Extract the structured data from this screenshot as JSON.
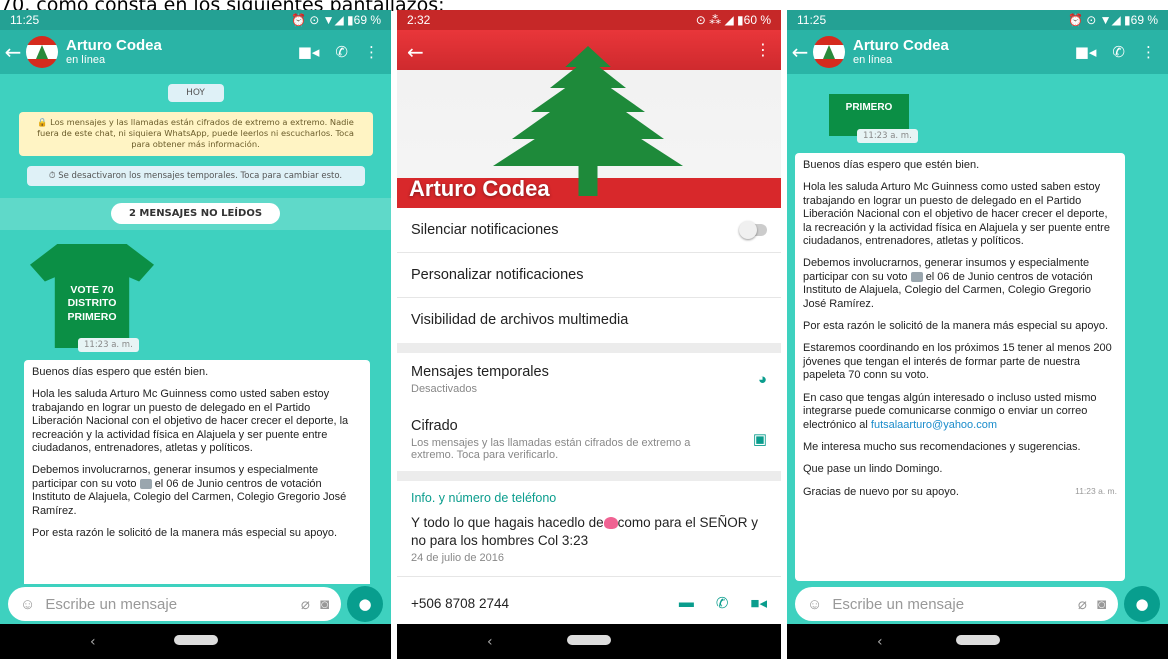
{
  "caption": "70, como consta en los siguientes pantallazos:",
  "panel1": {
    "status_time": "11:25",
    "status_right": "⏰ ⊙ ▼◢ ▮69 %",
    "contact_name": "Arturo Codea",
    "contact_status": "en línea",
    "date_badge": "HOY",
    "encryption_notice": "🔒 Los mensajes y las llamadas están cifrados de extremo a extremo. Nadie fuera de este chat, ni siquiera WhatsApp, puede leerlos ni escucharlos. Toca para obtener más información.",
    "temp_notice": "⏱ Se desactivaron los mensajes temporales. Toca para cambiar esto.",
    "unread_label": "2 MENSAJES NO LEÍDOS",
    "shirt_text": "VOTE 70\nDISTRITO\nPRIMERO",
    "image_time": "11:23 a. m.",
    "msg_p1": "Buenos días espero que estén bien.",
    "msg_p2": "Hola les saluda Arturo Mc Guinness como usted saben estoy trabajando en lograr un puesto de delegado en el Partido Liberación Nacional con el objetivo de hacer crecer el deporte, la recreación y la actividad física en Alajuela y ser puente entre ciudadanos, entrenadores, atletas  y políticos.",
    "msg_p3a": "Debemos involucrarnos, generar insumos y especialmente participar con su voto",
    "msg_p3b": "el 06 de Junio centros de votación Instituto de Alajuela, Colegio del Carmen, Colegio Gregorio José Ramírez.",
    "msg_p4": "Por esta razón le solicitó de la manera más especial su apoyo.",
    "composer_placeholder": "Escribe un mensaje"
  },
  "panel2": {
    "status_time": "2:32",
    "status_right": "⊙ ⁂ ◢ ▮60 %",
    "profile_name": "Arturo Codea",
    "mute_label": "Silenciar notificaciones",
    "custom_notif_label": "Personalizar notificaciones",
    "media_visibility_label": "Visibilidad de archivos multimedia",
    "temp_msgs_label": "Mensajes temporales",
    "temp_msgs_value": "Desactivados",
    "encryption_label": "Cifrado",
    "encryption_desc": "Los mensajes y las llamadas están cifrados de extremo a extremo. Toca para verificarlo.",
    "info_header": "Info. y número de teléfono",
    "about_a": "Y todo lo que hagais hacedlo de",
    "about_b": "como para el SEÑOR y no para los hombres Col 3:23",
    "about_date": "24 de julio de 2016",
    "phone": "+506 8708 2744"
  },
  "panel3": {
    "status_time": "11:25",
    "status_right": "⏰ ⊙ ▼◢ ▮69 %",
    "contact_name": "Arturo Codea",
    "contact_status": "en línea",
    "shirt_text": "PRIMERO",
    "image_time": "11:23 a. m.",
    "msg_p1": "Buenos días espero que estén bien.",
    "msg_p2": "Hola les saluda Arturo Mc Guinness como usted saben estoy trabajando en lograr un puesto de delegado en el Partido Liberación Nacional con el objetivo de hacer crecer el deporte, la recreación y la actividad física en Alajuela y ser puente entre ciudadanos, entrenadores, atletas  y políticos.",
    "msg_p3a": "Debemos involucrarnos, generar insumos y especialmente participar con su voto",
    "msg_p3b": "el 06 de Junio centros de votación Instituto de Alajuela, Colegio del Carmen, Colegio Gregorio José Ramírez.",
    "msg_p4": "Por esta razón le solicitó de la manera más especial su apoyo.",
    "msg_p5": "Estaremos coordinando en los próximos 15 tener al menos 200 jóvenes que tengan el interés de formar parte de nuestra papeleta 70 conn su voto.",
    "msg_p6a": "En caso que tengas algún interesado o incluso usted mismo integrarse puede comunicarse conmigo o enviar un correo electrónico al",
    "email": "futsalaarturo@yahoo.com",
    "msg_p7": "Me interesa mucho sus recomendaciones y sugerencias.",
    "msg_p8": "Que pase un lindo Domingo.",
    "msg_p9": "Gracias de nuevo por su apoyo.",
    "msg_time": "11:23 a. m.",
    "composer_placeholder": "Escribe un mensaje"
  },
  "colors": {
    "header": "#2ab4a6",
    "chat_bg": "#3ed1bf",
    "accent": "#0a9d8d"
  }
}
